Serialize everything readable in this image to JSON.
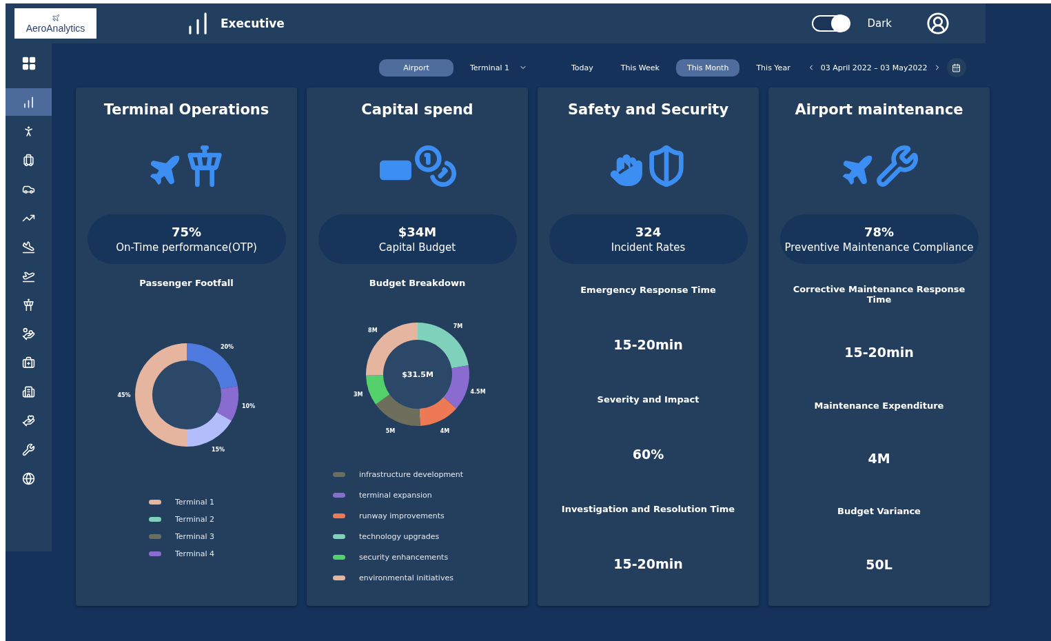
{
  "header": {
    "logo": "AeroAnalytics",
    "title": "Executive",
    "theme_toggle": {
      "on": true,
      "label": "Dark"
    }
  },
  "sidebar": {
    "items": [
      {
        "selected": true
      },
      {
        "selected": false
      },
      {
        "selected": false
      },
      {
        "selected": false
      },
      {
        "selected": false
      },
      {
        "selected": false
      },
      {
        "selected": false
      },
      {
        "selected": false
      },
      {
        "selected": false
      },
      {
        "selected": false
      },
      {
        "selected": false
      },
      {
        "selected": false
      },
      {
        "selected": false
      },
      {
        "selected": false
      }
    ]
  },
  "filters": {
    "scope_tabs": [
      {
        "label": "Airport",
        "selected": true,
        "kind": "tab"
      },
      {
        "label": "Terminal 1",
        "selected": false,
        "kind": "dropdown"
      }
    ],
    "period_tabs": [
      {
        "label": "Today",
        "selected": false
      },
      {
        "label": "This Week",
        "selected": false
      },
      {
        "label": "This Month",
        "selected": true
      },
      {
        "label": "This Year",
        "selected": false
      }
    ],
    "date_range": "03 April 2022  –  03 May2022"
  },
  "cards": [
    {
      "title": "Terminal Operations",
      "kind": "chart",
      "kpi": {
        "value": "75%",
        "label": "On-Time performance(OTP)"
      },
      "subtitle": "Passenger Footfall",
      "chart_data": {
        "type": "donut",
        "values": [
          20,
          10,
          15,
          45
        ],
        "colors": [
          "#4f7be0",
          "#8a6cd0",
          "#b4bdfc",
          "#e5b59f"
        ],
        "value_labels": [
          "20%",
          "10%",
          "15%",
          "45%"
        ]
      },
      "legend": [
        {
          "label": "Terminal 1",
          "color": "#e5b59f"
        },
        {
          "label": "Terminal 2",
          "color": "#7fd1bc"
        },
        {
          "label": "Terminal 3",
          "color": "#6e6e5c"
        },
        {
          "label": "Terminal 4",
          "color": "#8a6cd0"
        }
      ]
    },
    {
      "title": "Capital spend",
      "kind": "chart",
      "kpi": {
        "value": "$34M",
        "label": "Capital Budget"
      },
      "subtitle": "Budget Breakdown",
      "chart_data": {
        "type": "donut",
        "values": [
          7,
          4.5,
          4,
          5,
          3,
          8
        ],
        "colors": [
          "#7fd1bc",
          "#8a6cd0",
          "#ee7a55",
          "#6e6e5c",
          "#55d16c",
          "#e5b59f"
        ],
        "value_labels": [
          "7M",
          "4.5M",
          "4M",
          "5M",
          "3M",
          "8M"
        ],
        "annotations": [
          {
            "text": "$31.5M"
          }
        ]
      },
      "legend": [
        {
          "label": "infrastructure development",
          "color": "#6e6e5c"
        },
        {
          "label": "terminal expansion",
          "color": "#8a6cd0"
        },
        {
          "label": "runway improvements",
          "color": "#ee7a55"
        },
        {
          "label": "technology upgrades",
          "color": "#7fd1bc"
        },
        {
          "label": "security enhancements",
          "color": "#55d16c"
        },
        {
          "label": "environmental initiatives",
          "color": "#e5b59f"
        }
      ]
    },
    {
      "title": "Safety and Security",
      "kind": "metrics",
      "kpi": {
        "value": "324",
        "label": "Incident Rates"
      },
      "metrics": [
        {
          "label": "Emergency Response Time",
          "value": "15-20min"
        },
        {
          "label": "Severity and Impact",
          "value": "60%"
        },
        {
          "label": "Investigation and Resolution Time",
          "value": "15-20min"
        }
      ]
    },
    {
      "title": "Airport maintenance",
      "kind": "metrics",
      "kpi": {
        "value": "78%",
        "label": "Preventive Maintenance Compliance"
      },
      "metrics": [
        {
          "label": "Corrective Maintenance Response Time",
          "value": "15-20min"
        },
        {
          "label": "Maintenance Expenditure",
          "value": "4M"
        },
        {
          "label": "Budget Variance",
          "value": "50L"
        }
      ]
    }
  ]
}
